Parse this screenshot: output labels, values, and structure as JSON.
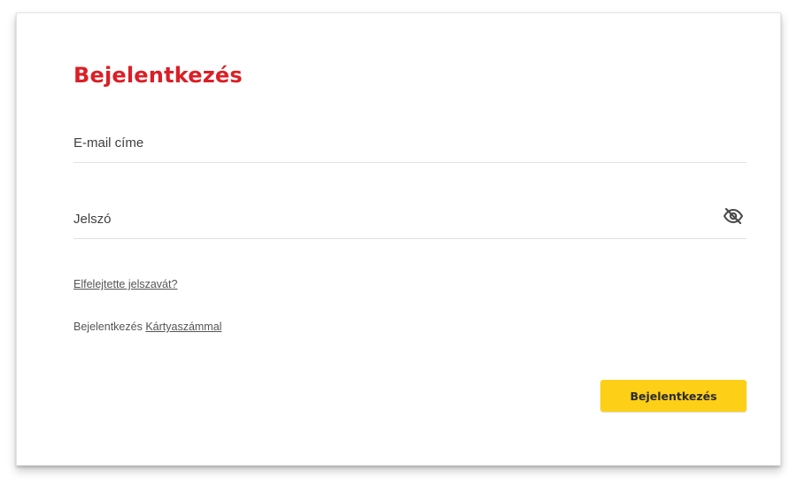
{
  "login": {
    "title": "Bejelentkezés",
    "email_placeholder": "E-mail címe",
    "email_value": "",
    "password_placeholder": "Jelszó",
    "password_value": "",
    "password_toggle_icon": "eye-off-icon",
    "forgot_password_link": "Elfelejtette jelszavát?",
    "card_login_prefix": "Bejelentkezés",
    "card_login_link": "Kártyaszámmal",
    "submit_label": "Bejelentkezés"
  },
  "colors": {
    "title": "#db1f26",
    "primary_button": "#fdcf16",
    "text": "#555555",
    "divider": "#e1e1e1"
  }
}
